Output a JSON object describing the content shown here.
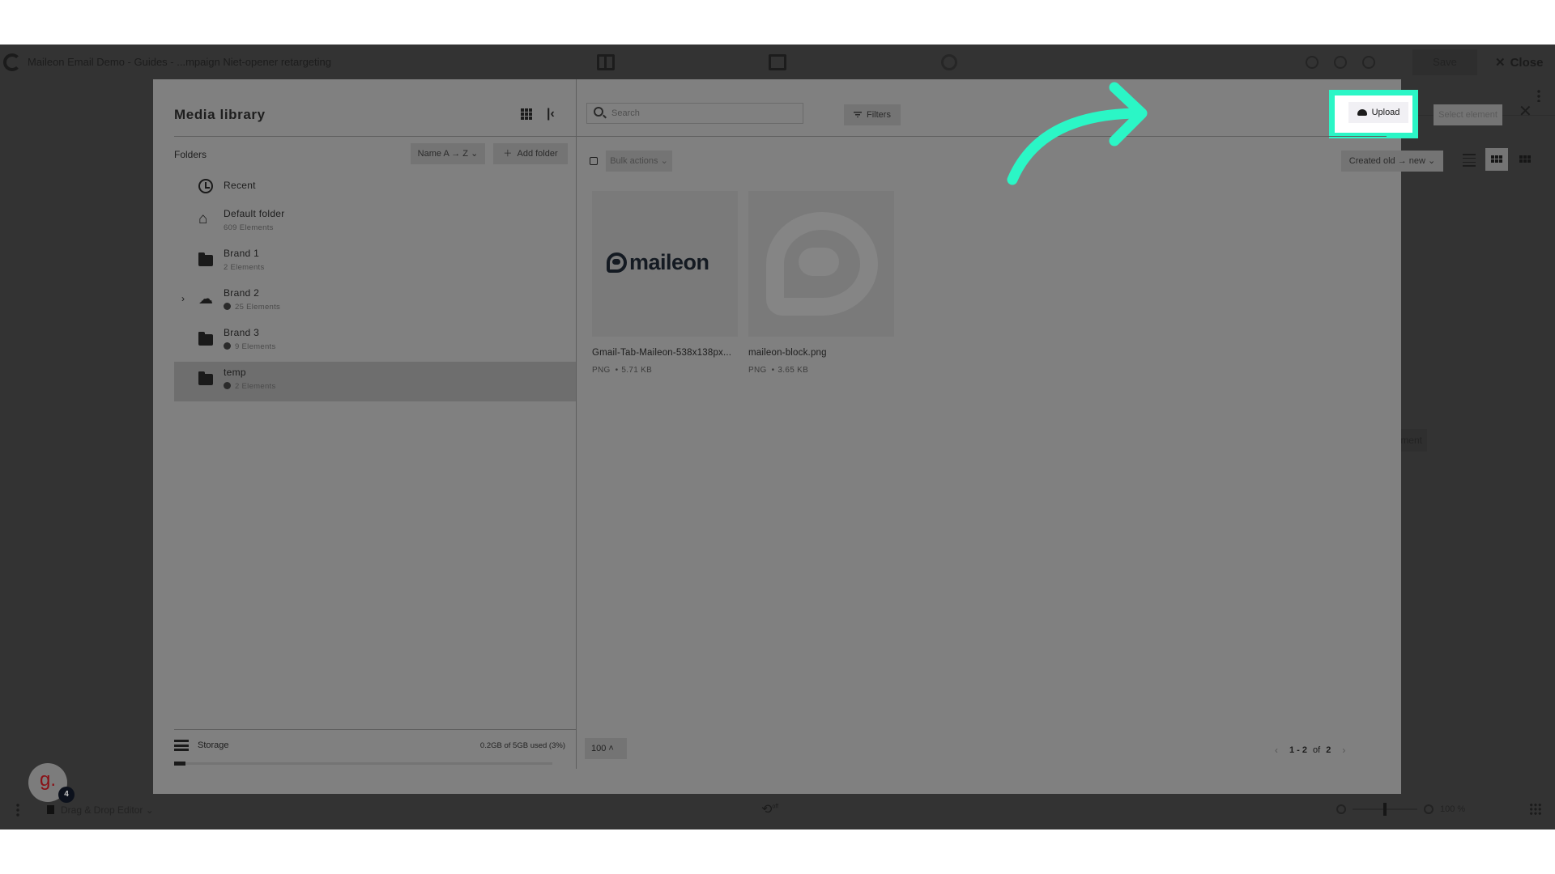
{
  "app": {
    "title": "Maileon Email Demo - Guides - ...mpaign Niet-opener retargeting",
    "save_label": "Save",
    "close_label": "Close",
    "bottom": {
      "editor_label": "Drag & Drop Editor",
      "undo_badge": "off",
      "zoom_level": "100 %"
    },
    "ghost_button_label": "ment",
    "guide": {
      "letter": "g.",
      "badge_count": "4"
    }
  },
  "modal": {
    "title": "Media library",
    "folders_label": "Folders",
    "sort_label": "Name A → Z",
    "add_folder_label": "Add folder",
    "folders": [
      {
        "name": "Recent",
        "icon": "clock-icon",
        "count": ""
      },
      {
        "name": "Default folder",
        "icon": "home-icon",
        "count": "609 Elements",
        "shared": false
      },
      {
        "name": "Brand 1",
        "icon": "folder-icon",
        "count": "2 Elements",
        "shared": false
      },
      {
        "name": "Brand 2",
        "icon": "cloud-upload-icon",
        "count": "25 Elements",
        "shared": true,
        "expandable": true
      },
      {
        "name": "Brand 3",
        "icon": "folder-icon",
        "count": "9 Elements",
        "shared": true
      },
      {
        "name": "temp",
        "icon": "folder-icon",
        "count": "2 Elements",
        "shared": true,
        "selected": true
      }
    ],
    "storage": {
      "label": "Storage",
      "usage_text": "0.2GB of 5GB used (3%)",
      "used_percent": 3
    },
    "search": {
      "placeholder": "Search",
      "value": ""
    },
    "filters_label": "Filters",
    "upload_label": "Upload",
    "select_element_label": "Select element",
    "bulk_actions_label": "Bulk actions",
    "sort_by_label": "Created old → new",
    "view_modes": [
      "list",
      "grid",
      "masonry"
    ],
    "active_view": "grid",
    "items": [
      {
        "name": "Gmail-Tab-Maileon-538x138px...",
        "type": "PNG",
        "size": "5.71 KB",
        "preview_text": "maileon"
      },
      {
        "name": "maileon-block.png",
        "type": "PNG",
        "size": "3.65 KB"
      }
    ],
    "per_page": "100",
    "pagination": {
      "range": "1 - 2",
      "of_label": "of",
      "total": "2"
    }
  },
  "annotation": {
    "highlight_color": "#2bf6c6"
  }
}
